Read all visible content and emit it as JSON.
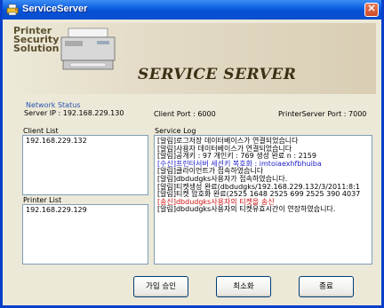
{
  "window": {
    "title": "ServiceServer",
    "close_glyph": "✕"
  },
  "banner": {
    "logo_line1": "Printer",
    "logo_line2": "Security",
    "logo_line3": "Solution",
    "title": "SERVICE SERVER"
  },
  "network": {
    "heading": "Network Status",
    "server_ip": "Server IP : 192.168.229.130",
    "client_port": "Client Port : 6000",
    "printer_server_port": "PrinterServer Port : 7000"
  },
  "client_list": {
    "label": "Client List",
    "items": [
      "192.168.229.132"
    ]
  },
  "printer_list": {
    "label": "Printer List",
    "items": [
      "192.168.229.129"
    ]
  },
  "service_log": {
    "label": "Service Log",
    "lines": [
      {
        "text": "[알림]로그저장 데이터베이스가 연결되었습니다",
        "color": "black"
      },
      {
        "text": "[알림]사용자 데이터베이스가 연결되었습니다",
        "color": "black"
      },
      {
        "text": "[알림]공개키 : 97 개인키 : 769 생성 완료 n : 2159",
        "color": "black"
      },
      {
        "text": "[수신]프린터서버 세션키 복호화 : imtoiaexhfbhuiba",
        "color": "blue"
      },
      {
        "text": "[알림]클라이언트가 접속하였습니다",
        "color": "black"
      },
      {
        "text": "[알림]dbdudgks사용자가 접속하였습니다.",
        "color": "black"
      },
      {
        "text": "[알림]티켓생성 완료(dbdudgks/192.168.229.132/3/2011:8:1",
        "color": "black"
      },
      {
        "text": "[알림]티켓 암호화 완료(2525 1648 2525 699 2525 390 4037",
        "color": "black"
      },
      {
        "text": "[송신]dbdudgks사용자의 티켓을 송신",
        "color": "red"
      },
      {
        "text": "[알림]dbdudgks사용자의 티켓유효시간이 연장하였습니다.",
        "color": "black"
      }
    ]
  },
  "buttons": {
    "join_approve": "가입 승인",
    "minimize": "최소화",
    "exit": "종료"
  },
  "colors": {
    "titlebar": "#0a5ee0",
    "log_blue": "#2222cc",
    "log_red": "#d01010",
    "status_blue": "#2b52b0"
  }
}
